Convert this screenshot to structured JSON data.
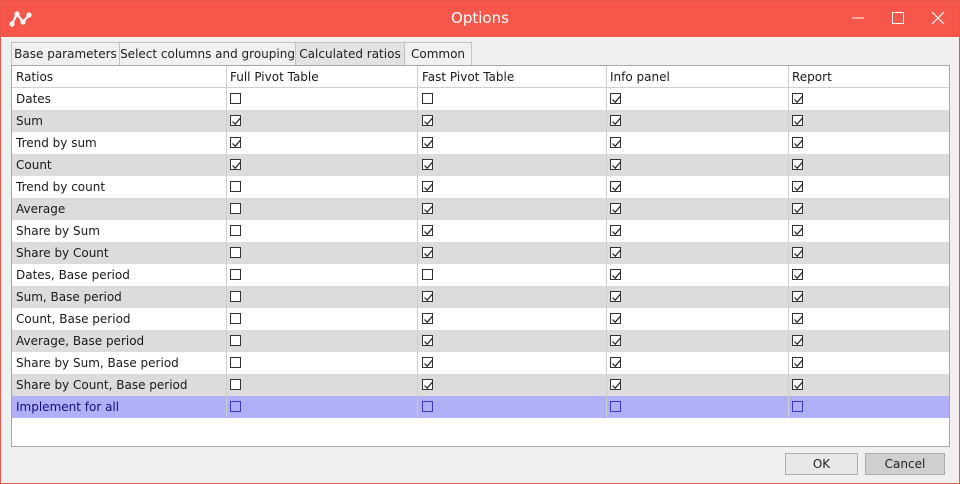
{
  "window": {
    "title": "Options"
  },
  "tabs": [
    {
      "label": "Base parameters"
    },
    {
      "label": "Select columns and grouping"
    },
    {
      "label": "Calculated ratios"
    },
    {
      "label": "Common"
    }
  ],
  "active_tab": "Calculated ratios",
  "grid": {
    "columns": [
      "Ratios",
      "Full Pivot Table",
      "Fast Pivot Table",
      "Info panel",
      "Report"
    ],
    "rows": [
      {
        "label": "Dates",
        "checks": [
          false,
          false,
          true,
          true
        ]
      },
      {
        "label": "Sum",
        "checks": [
          true,
          true,
          true,
          true
        ]
      },
      {
        "label": "Trend by sum",
        "checks": [
          true,
          true,
          true,
          true
        ]
      },
      {
        "label": "Count",
        "checks": [
          true,
          true,
          true,
          true
        ]
      },
      {
        "label": "Trend by count",
        "checks": [
          false,
          true,
          true,
          true
        ]
      },
      {
        "label": "Average",
        "checks": [
          false,
          true,
          true,
          true
        ]
      },
      {
        "label": "Share by Sum",
        "checks": [
          false,
          true,
          true,
          true
        ]
      },
      {
        "label": "Share by Count",
        "checks": [
          false,
          true,
          true,
          true
        ]
      },
      {
        "label": "Dates, Base period",
        "checks": [
          false,
          false,
          true,
          true
        ]
      },
      {
        "label": "Sum, Base period",
        "checks": [
          false,
          true,
          true,
          true
        ]
      },
      {
        "label": "Count, Base period",
        "checks": [
          false,
          true,
          true,
          true
        ]
      },
      {
        "label": "Average, Base period",
        "checks": [
          false,
          true,
          true,
          true
        ]
      },
      {
        "label": "Share by Sum, Base period",
        "checks": [
          false,
          true,
          true,
          true
        ]
      },
      {
        "label": "Share by Count, Base period",
        "checks": [
          false,
          true,
          true,
          true
        ]
      },
      {
        "label": "Implement for all",
        "checks": [
          false,
          false,
          false,
          false
        ],
        "selected": true
      }
    ]
  },
  "buttons": {
    "ok": "OK",
    "cancel": "Cancel"
  },
  "colors": {
    "titlebar": "#f5574b",
    "selected_row": "#b0b0f8",
    "alt_row": "#dcdcdc"
  }
}
